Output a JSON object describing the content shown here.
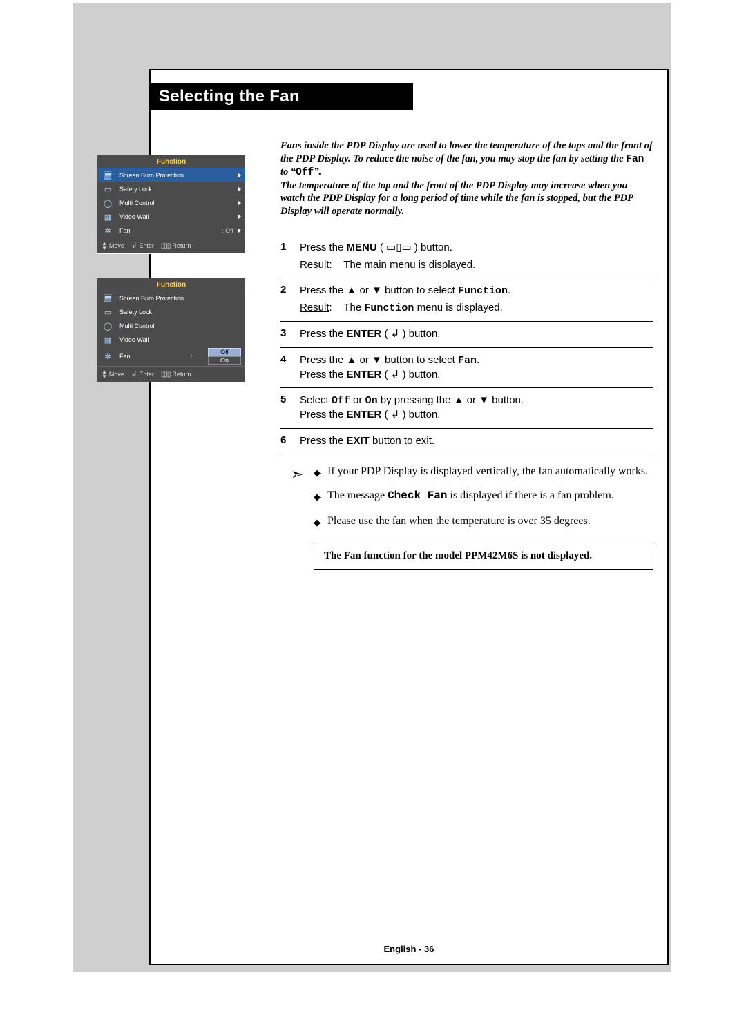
{
  "title": "Selecting the Fan",
  "osd": {
    "header": "Function",
    "items": [
      {
        "icon": "🖥",
        "label": "Screen Burn Protection",
        "value": "",
        "arrow": true
      },
      {
        "icon": "▭",
        "label": "Safety Lock",
        "value": "",
        "arrow": true
      },
      {
        "icon": "◯",
        "label": "Multi Control",
        "value": "",
        "arrow": true
      },
      {
        "icon": "▦",
        "label": "Video Wall",
        "value": "",
        "arrow": true
      },
      {
        "icon": "✲",
        "label": "Fan",
        "value": ": Off",
        "arrow": true
      }
    ],
    "footer": {
      "move": "Move",
      "enter": "Enter",
      "return": "Return"
    },
    "options": {
      "off": "Off",
      "on": "On",
      "selected": "Off"
    }
  },
  "intro": {
    "p1a": "Fans inside the PDP Display are used to lower the temperature of the tops and the front of the PDP Display. To reduce the noise of the fan, you may stop the fan by setting the ",
    "p1b": "Fan",
    "p1c": " to “",
    "p1d": "Off",
    "p1e": "”.",
    "p2": "The temperature of the top and the front of the PDP Display may increase when you watch the PDP Display for a long period of time while the fan is stopped, but the PDP Display will operate normally."
  },
  "labels": {
    "result": "Result",
    "menu": "MENU",
    "enter": "ENTER",
    "exit": "EXIT",
    "function": "Function",
    "fan": "Fan",
    "off": "Off",
    "on": "On"
  },
  "steps": [
    {
      "n": "1",
      "l1a": "Press the ",
      "l1b": " ( ▭▯▭ ) button.",
      "r": "The main menu is displayed."
    },
    {
      "n": "2",
      "l1a": "Press the ▲ or ▼ button to select ",
      "l1b": ".",
      "r_a": "The ",
      "r_b": " menu is displayed."
    },
    {
      "n": "3",
      "l1a": "Press the ",
      "l1b": " ( ↲ ) button."
    },
    {
      "n": "4",
      "l1a": "Press the ▲ or ▼ button to select ",
      "l1b": ".",
      "l2a": "Press the ",
      "l2b": " ( ↲ ) button."
    },
    {
      "n": "5",
      "l1a": "Select ",
      "l1b": " or ",
      "l1c": " by pressing the ▲ or ▼ button.",
      "l2a": "Press the ",
      "l2b": " ( ↲ ) button."
    },
    {
      "n": "6",
      "l1a": "Press the ",
      "l1b": " button to exit."
    }
  ],
  "bullets": [
    {
      "a": "If your PDP Display is displayed vertically, the fan automatically works."
    },
    {
      "a": "The message ",
      "mono": "Check Fan",
      "b": " is displayed if there is a fan problem."
    },
    {
      "a": "Please use the fan when the temperature is over 35 degrees."
    }
  ],
  "notebox": "The Fan function for the model PPM42M6S is not displayed.",
  "footer": "English - 36"
}
